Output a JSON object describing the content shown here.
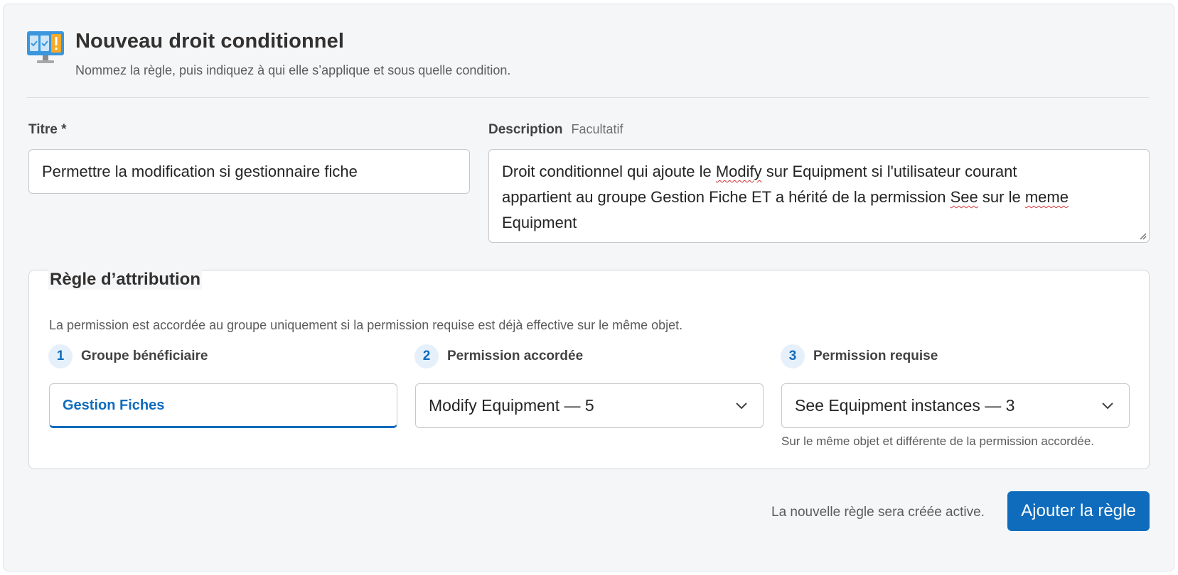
{
  "header": {
    "title": "Nouveau droit conditionnel",
    "subtitle": "Nommez la règle, puis indiquez à qui elle s’applique et sous quelle condition.",
    "icon": "monitor-checklist-warning-icon"
  },
  "form": {
    "title_label": "Titre *",
    "title_value": "Permettre la modification si gestionnaire fiche",
    "description_label": "Description",
    "description_hint": "Facultatif",
    "description_parts": [
      "Droit conditionnel qui ajoute le ",
      "Modify",
      " sur Equipment si l'utilisateur courant",
      "appartient au groupe Gestion Fiche ET a hérité de la permission ",
      "See",
      " sur le ",
      "meme",
      "Equipment"
    ]
  },
  "rule": {
    "legend": "Règle d’attribution",
    "description": "La permission est accordée au groupe uniquement si la permission requise est déjà effective sur le même objet.",
    "steps": [
      {
        "number": "1",
        "label": "Groupe bénéficiaire",
        "value": "Gestion Fiches"
      },
      {
        "number": "2",
        "label": "Permission accordée",
        "value": "Modify Equipment — 5"
      },
      {
        "number": "3",
        "label": "Permission requise",
        "value": "See Equipment instances — 3"
      }
    ],
    "required_note": "Sur le même objet et différente de la permission accordée."
  },
  "footer": {
    "note": "La nouvelle règle sera créée active.",
    "submit_label": "Ajouter la règle"
  },
  "colors": {
    "accent": "#0f6cbd",
    "background": "#f5f6f8",
    "spellcheck": "#d13438"
  }
}
